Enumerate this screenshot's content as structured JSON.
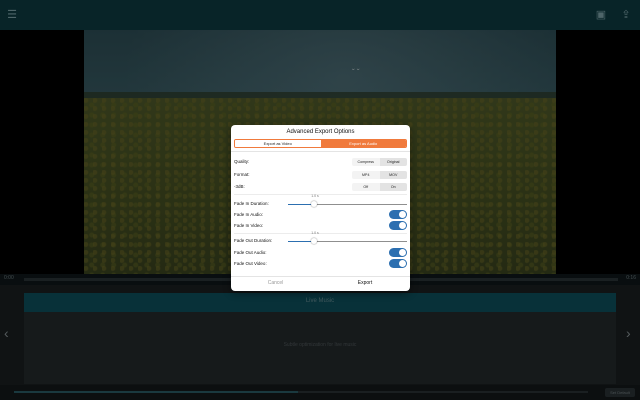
{
  "app": {
    "icons": {
      "menu": "menu-icon",
      "save": "save-icon",
      "share": "share-icon"
    },
    "timeline": {
      "start": "0:00",
      "end": "0:16"
    },
    "music": {
      "header": "Live Music",
      "hint": "Subtle optimization for live music",
      "bottom_button": "Set Default"
    }
  },
  "modal": {
    "title": "Advanced Export Options",
    "tabs": {
      "video": "Export as Video",
      "audio": "Export as Audio",
      "selected": "audio"
    },
    "quality": {
      "label": "Quality:",
      "options": [
        "Compress",
        "Original"
      ],
      "selected": "Original"
    },
    "format": {
      "label": "Format:",
      "options": [
        "MP4",
        "MOV"
      ],
      "selected": "MOV"
    },
    "db": {
      "label": "-3dB:",
      "options": [
        "Off",
        "On"
      ],
      "selected": "On"
    },
    "fade_in_duration": {
      "label": "Fade In Duration:",
      "value_label": "1.0 s",
      "fraction": 0.22
    },
    "fade_in_audio": {
      "label": "Fade In Audio:",
      "on": true
    },
    "fade_in_video": {
      "label": "Fade In Video:",
      "on": true
    },
    "fade_out_duration": {
      "label": "Fade Out Duration:",
      "value_label": "1.0 s",
      "fraction": 0.22
    },
    "fade_out_audio": {
      "label": "Fade Out Audio:",
      "on": true
    },
    "fade_out_video": {
      "label": "Fade Out Video:",
      "on": true
    },
    "cancel": "Cancel",
    "export": "Export"
  },
  "colors": {
    "accent": "#f07a3c",
    "toggle_on": "#2c6fb0",
    "header_teal": "#0d4f5c"
  }
}
